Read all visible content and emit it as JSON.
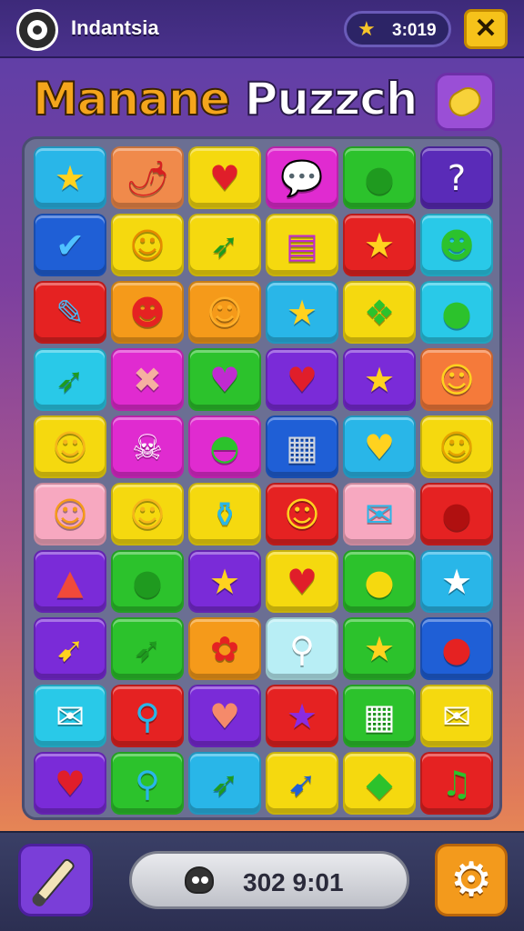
{
  "header": {
    "app_name": "Indantsia",
    "coin_value": "3:019",
    "close_label": "✕"
  },
  "title": {
    "part1": "Manane",
    "part2": "Puzzch"
  },
  "board": {
    "rows": [
      [
        {
          "icon": "star-icon",
          "glyph": "★",
          "bg": "#29b6e8",
          "fg": "#ffd21f"
        },
        {
          "icon": "chili-icon",
          "glyph": "🌶",
          "bg": "#f08a4b",
          "fg": "#d62020"
        },
        {
          "icon": "heart-icon",
          "glyph": "♥",
          "bg": "#f5d90f",
          "fg": "#e01e2a"
        },
        {
          "icon": "speech-bubble-icon",
          "glyph": "💬",
          "bg": "#e02bd0",
          "fg": "#4fb4f0"
        },
        {
          "icon": "chat-bubble-icon",
          "glyph": "●",
          "bg": "#2cc22c",
          "fg": "#1f9a1f"
        },
        {
          "icon": "question-mark-icon",
          "glyph": "?",
          "bg": "#5a2bb8",
          "fg": "#ffffff"
        }
      ],
      [
        {
          "icon": "check-icon",
          "glyph": "✔",
          "bg": "#1f5fd6",
          "fg": "#4fc1ff"
        },
        {
          "icon": "smiley-icon",
          "glyph": "☺",
          "bg": "#f5d90f",
          "fg": "#e58a00"
        },
        {
          "icon": "arrow-tree-icon",
          "glyph": "➶",
          "bg": "#f5d90f",
          "fg": "#1f9a1f"
        },
        {
          "icon": "cassette-icon",
          "glyph": "▤",
          "bg": "#f5d90f",
          "fg": "#c02bd0"
        },
        {
          "icon": "star-icon",
          "glyph": "★",
          "bg": "#e52222",
          "fg": "#ffd21f"
        },
        {
          "icon": "slime-icon",
          "glyph": "☻",
          "bg": "#29c9e8",
          "fg": "#2cc22c"
        }
      ],
      [
        {
          "icon": "feather-icon",
          "glyph": "✎",
          "bg": "#e52222",
          "fg": "#4fb4f0"
        },
        {
          "icon": "tomato-face-icon",
          "glyph": "☻",
          "bg": "#f59a1a",
          "fg": "#e52222"
        },
        {
          "icon": "speech-face-icon",
          "glyph": "☺",
          "bg": "#f59a1a",
          "fg": "#ffb02a"
        },
        {
          "icon": "star-icon",
          "glyph": "★",
          "bg": "#29b6e8",
          "fg": "#ffd21f"
        },
        {
          "icon": "money-icon",
          "glyph": "❖",
          "bg": "#f5d90f",
          "fg": "#2cc22c"
        },
        {
          "icon": "green-ball-icon",
          "glyph": "●",
          "bg": "#29c9e8",
          "fg": "#2cc22c"
        }
      ],
      [
        {
          "icon": "arrow-tree-icon",
          "glyph": "➶",
          "bg": "#29c9e8",
          "fg": "#1f9a1f"
        },
        {
          "icon": "bandage-icon",
          "glyph": "✖",
          "bg": "#e02bd0",
          "fg": "#f5b0a0"
        },
        {
          "icon": "heart-icon",
          "glyph": "♥",
          "bg": "#2cc22c",
          "fg": "#c02bd0"
        },
        {
          "icon": "heart-icon",
          "glyph": "♥",
          "bg": "#7a2bd8",
          "fg": "#e01e2a"
        },
        {
          "icon": "star-icon",
          "glyph": "★",
          "bg": "#7a2bd8",
          "fg": "#ffd21f"
        },
        {
          "icon": "smiley-icon",
          "glyph": "☺",
          "bg": "#f57a3a",
          "fg": "#ffd21f"
        }
      ],
      [
        {
          "icon": "ghost-face-icon",
          "glyph": "☺",
          "bg": "#f5d90f",
          "fg": "#f5b51a"
        },
        {
          "icon": "skull-icon",
          "glyph": "☠",
          "bg": "#e02bd0",
          "fg": "#ffffff"
        },
        {
          "icon": "watermelon-icon",
          "glyph": "◓",
          "bg": "#e02bd0",
          "fg": "#2cc22c"
        },
        {
          "icon": "calendar-icon",
          "glyph": "▦",
          "bg": "#1f5fd6",
          "fg": "#cfd6e0"
        },
        {
          "icon": "heart-icon",
          "glyph": "♥",
          "bg": "#29b6e8",
          "fg": "#ffd21f"
        },
        {
          "icon": "thinking-face-icon",
          "glyph": "☺",
          "bg": "#f5d90f",
          "fg": "#e5a300"
        }
      ],
      [
        {
          "icon": "smiley-icon",
          "glyph": "☺",
          "bg": "#f7a8c0",
          "fg": "#f59a1a"
        },
        {
          "icon": "smiley-icon",
          "glyph": "☺",
          "bg": "#f5d90f",
          "fg": "#f5b51a"
        },
        {
          "icon": "bottle-icon",
          "glyph": "⚱",
          "bg": "#f5d90f",
          "fg": "#29b6e8"
        },
        {
          "icon": "smiley-icon",
          "glyph": "☺",
          "bg": "#e52222",
          "fg": "#ffd21f"
        },
        {
          "icon": "envelope-icon",
          "glyph": "✉",
          "bg": "#f7a8c0",
          "fg": "#29b6e8"
        },
        {
          "icon": "balloon-icon",
          "glyph": "●",
          "bg": "#e52222",
          "fg": "#b01010"
        }
      ],
      [
        {
          "icon": "cone-icon",
          "glyph": "▲",
          "bg": "#7a2bd8",
          "fg": "#f04a3a"
        },
        {
          "icon": "leaf-icon",
          "glyph": "●",
          "bg": "#2cc22c",
          "fg": "#1f9a1f"
        },
        {
          "icon": "star-icon",
          "glyph": "★",
          "bg": "#7a2bd8",
          "fg": "#ffd21f"
        },
        {
          "icon": "heart-icon",
          "glyph": "♥",
          "bg": "#f5d90f",
          "fg": "#e01e2a"
        },
        {
          "icon": "speech-bubble-icon",
          "glyph": "●",
          "bg": "#2cc22c",
          "fg": "#f5d90f"
        },
        {
          "icon": "star-icon",
          "glyph": "★",
          "bg": "#29b6e8",
          "fg": "#ffffff"
        }
      ],
      [
        {
          "icon": "cursor-icon",
          "glyph": "➹",
          "bg": "#7a2bd8",
          "fg": "#ffd21f"
        },
        {
          "icon": "arrow-tree-icon",
          "glyph": "➶",
          "bg": "#2cc22c",
          "fg": "#1f9a1f"
        },
        {
          "icon": "flower-icon",
          "glyph": "✿",
          "bg": "#f59a1a",
          "fg": "#e52222"
        },
        {
          "icon": "magnifier-icon",
          "glyph": "⚲",
          "bg": "#b8eef5",
          "fg": "#ffffff"
        },
        {
          "icon": "star-icon",
          "glyph": "★",
          "bg": "#2cc22c",
          "fg": "#ffd21f"
        },
        {
          "icon": "apple-icon",
          "glyph": "●",
          "bg": "#1f5fd6",
          "fg": "#e52222"
        }
      ],
      [
        {
          "icon": "mail-icon",
          "glyph": "✉",
          "bg": "#29c9e8",
          "fg": "#ffffff"
        },
        {
          "icon": "magnifier-icon",
          "glyph": "⚲",
          "bg": "#e52222",
          "fg": "#29b6e8"
        },
        {
          "icon": "heart-icon",
          "glyph": "♥",
          "bg": "#7a2bd8",
          "fg": "#f58a6a"
        },
        {
          "icon": "star-icon",
          "glyph": "★",
          "bg": "#e52222",
          "fg": "#8a2be0"
        },
        {
          "icon": "calendar-icon",
          "glyph": "▦",
          "bg": "#2cc22c",
          "fg": "#ffffff"
        },
        {
          "icon": "mail-check-icon",
          "glyph": "✉",
          "bg": "#f5d90f",
          "fg": "#ffffff"
        }
      ],
      [
        {
          "icon": "heart-icon",
          "glyph": "♥",
          "bg": "#7a2bd8",
          "fg": "#e01e2a"
        },
        {
          "icon": "lollipop-icon",
          "glyph": "⚲",
          "bg": "#2cc22c",
          "fg": "#29b6e8"
        },
        {
          "icon": "arrow-tree-icon",
          "glyph": "➶",
          "bg": "#29b6e8",
          "fg": "#1f9a1f"
        },
        {
          "icon": "cursor-icon",
          "glyph": "➹",
          "bg": "#f5d90f",
          "fg": "#1f5fd6"
        },
        {
          "icon": "leaf-icon",
          "glyph": "◆",
          "bg": "#f5d90f",
          "fg": "#2cc22c"
        },
        {
          "icon": "music-note-icon",
          "glyph": "♫",
          "bg": "#e52222",
          "fg": "#2cc22c"
        }
      ]
    ]
  },
  "footer": {
    "score_value": "302 9:01"
  }
}
